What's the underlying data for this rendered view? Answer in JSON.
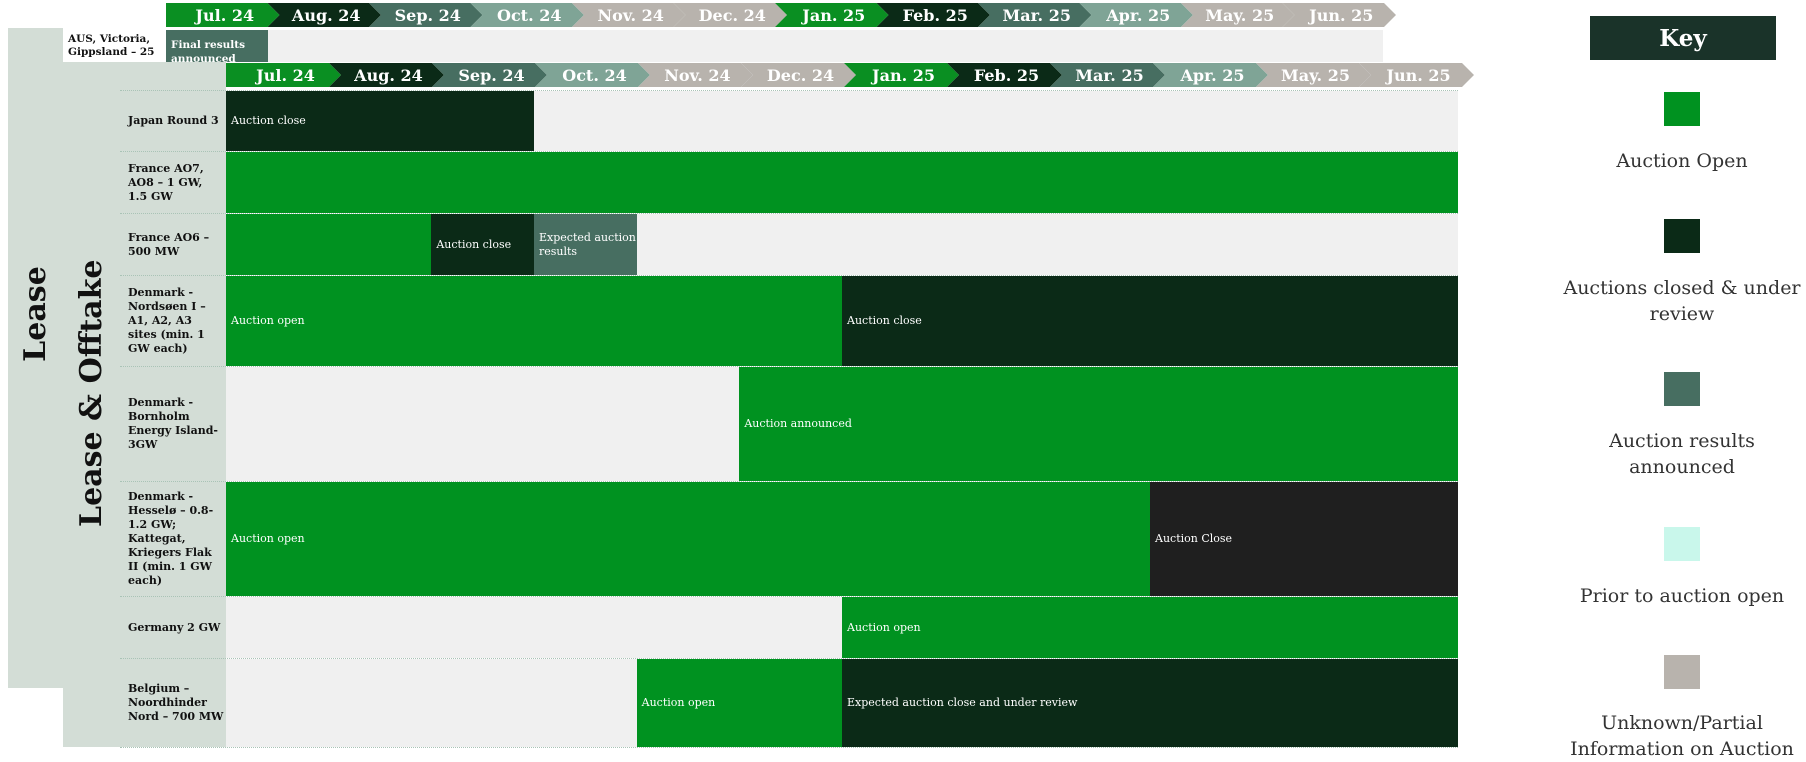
{
  "colors": {
    "open": "#009220",
    "closed": "#0b2a17",
    "results": "#476e61",
    "prior": "#c9f7eb",
    "unknown": "#b8b3ad",
    "blank": "#f0f0f0",
    "label_bg": "#d3ddd6",
    "auction_close_black": "#1f1f1f"
  },
  "months": [
    "Jul. 24",
    "Aug. 24",
    "Sep. 24",
    "Oct. 24",
    "Nov. 24",
    "Dec. 24",
    "Jan. 25",
    "Feb. 25",
    "Mar. 25",
    "Apr. 25",
    "May. 25",
    "Jun. 25"
  ],
  "sections": {
    "lease": "Lease",
    "lease_offtake": "Lease & Offtake"
  },
  "top_row": {
    "label": "AUS, Victoria, Gippsland – 25",
    "segment": "Final results announced"
  },
  "rows": [
    {
      "label": "Japan Round 3",
      "segments": [
        "Auction close"
      ]
    },
    {
      "label": "France AO7, AO8 – 1 GW, 1.5 GW",
      "segments": []
    },
    {
      "label": "France AO6 – 500 MW",
      "segments": [
        "Auction close",
        "Expected auction results"
      ]
    },
    {
      "label": "Denmark - Nordsøen I – A1, A2, A3 sites (min. 1 GW each)",
      "segments": [
        "Auction open",
        "Auction close"
      ]
    },
    {
      "label": "Denmark - Bornholm Energy Island- 3GW",
      "segments": [
        "Auction announced"
      ]
    },
    {
      "label": "Denmark - Hesselø – 0.8-1.2 GW; Kattegat, Kriegers Flak II (min. 1 GW each)",
      "segments": [
        "Auction open",
        "Auction Close"
      ]
    },
    {
      "label": "Germany 2 GW",
      "segments": [
        "Auction open"
      ]
    },
    {
      "label": "Belgium – Noordhinder Nord – 700 MW",
      "segments": [
        "Auction open",
        "Expected auction close and under review"
      ]
    }
  ],
  "key": {
    "title": "Key",
    "items": [
      {
        "label": "Auction Open",
        "color": "#009220"
      },
      {
        "label": "Auctions closed & under review",
        "color": "#0b2a17"
      },
      {
        "label": "Auction results announced",
        "color": "#476e61"
      },
      {
        "label": "Prior to auction open",
        "color": "#c9f7eb"
      },
      {
        "label": "Unknown/Partial Information on Auction",
        "color": "#b8b3ad"
      }
    ]
  }
}
